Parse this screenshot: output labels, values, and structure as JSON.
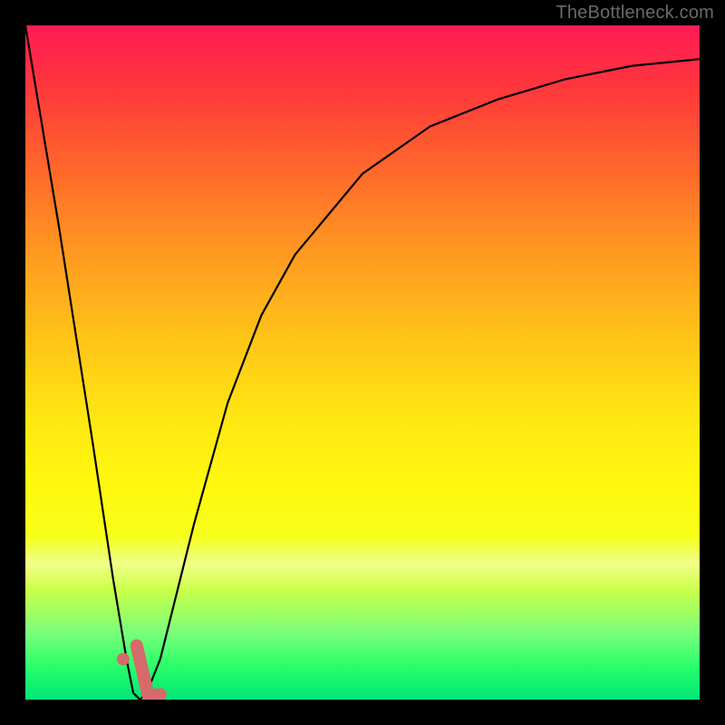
{
  "watermark": {
    "text": "TheBottleneck.com"
  },
  "colors": {
    "curve": "#000000",
    "marker_stroke": "#d66a6a",
    "marker_fill": "#d66a6a",
    "background_black": "#000000"
  },
  "chart_data": {
    "type": "line",
    "title": "",
    "xlabel": "",
    "ylabel": "",
    "xlim": [
      0,
      100
    ],
    "ylim": [
      0,
      100
    ],
    "grid": false,
    "legend": false,
    "series": [
      {
        "name": "bottleneck-curve",
        "x": [
          0,
          5,
          10,
          13,
          15,
          16,
          17,
          18,
          20,
          22,
          25,
          30,
          35,
          40,
          50,
          60,
          70,
          80,
          90,
          100
        ],
        "values": [
          100,
          70,
          38,
          18,
          6,
          1,
          0,
          1,
          6,
          14,
          26,
          44,
          57,
          66,
          78,
          85,
          89,
          92,
          94,
          95
        ]
      }
    ],
    "markers": [
      {
        "name": "selection-dot",
        "x": 14.5,
        "y": 6
      },
      {
        "name": "selection-tick-start",
        "x": 16.5,
        "y": 8
      },
      {
        "name": "selection-tick-end",
        "x": 20.0,
        "y": 0.5
      }
    ],
    "annotations": []
  }
}
